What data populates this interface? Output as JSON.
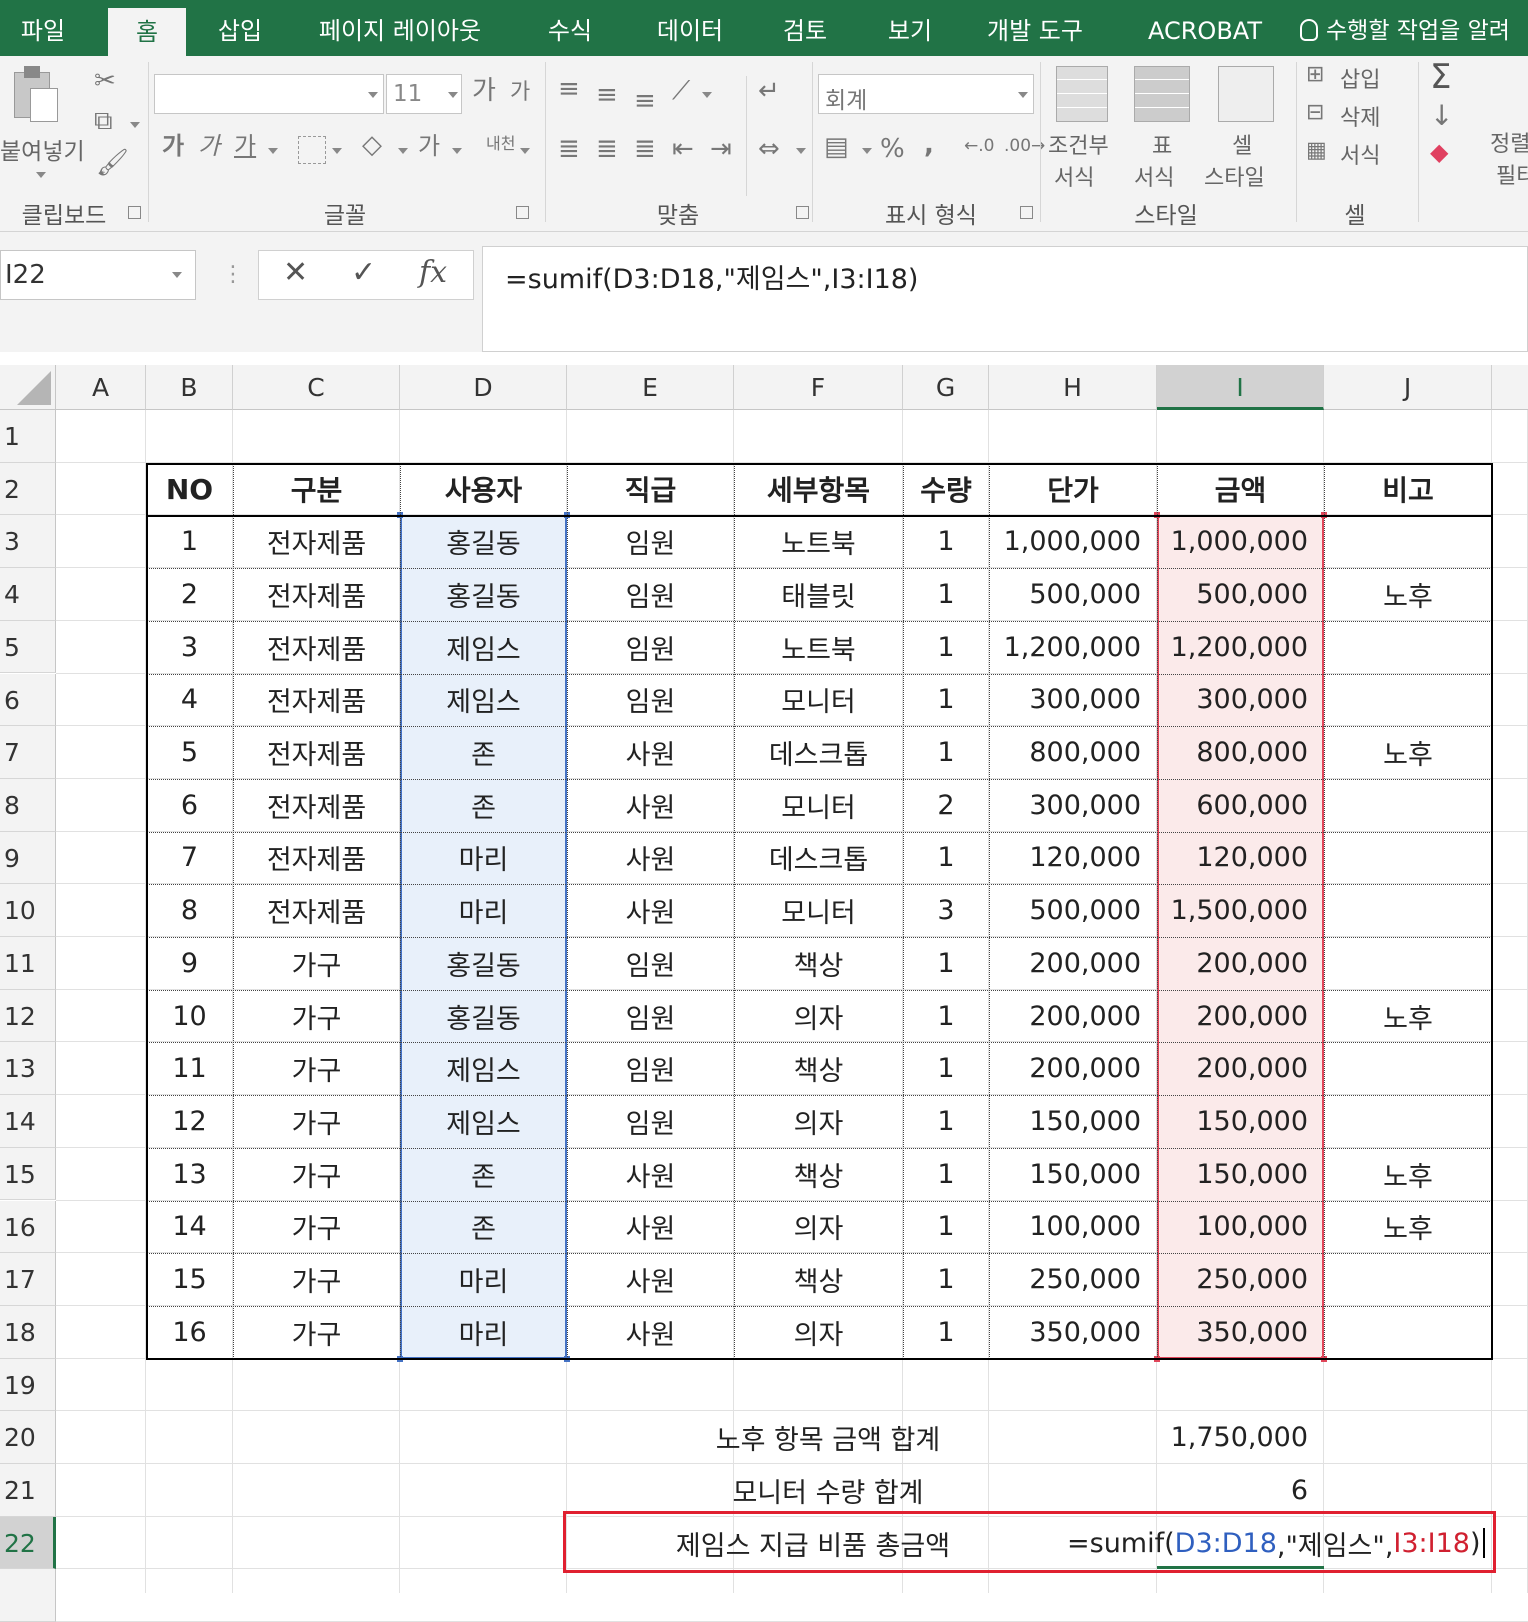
{
  "ribbon_tabs": [
    "파일",
    "홈",
    "삽입",
    "페이지 레이아웃",
    "수식",
    "데이터",
    "검토",
    "보기",
    "개발 도구",
    "ACROBAT"
  ],
  "active_tab": "홈",
  "tell_me": "수행할 작업을 알려",
  "ribbon": {
    "paste_label": "붙여넣기",
    "clipboard_group": "클립보드",
    "font_group": "글꼴",
    "font_size": "11",
    "align_group": "맞춤",
    "number_group": "표시 형식",
    "number_format": "회계",
    "styles_group": "스타일",
    "cond_format_1": "조건부",
    "cond_format_2": "서식",
    "table_format_1": "표",
    "table_format_2": "서식",
    "cell_style_1": "셀",
    "cell_style_2": "스타일",
    "cells_group": "셀",
    "insert_label": "삽입",
    "delete_label": "삭제",
    "format_label": "서식",
    "sort_label_1": "정렬",
    "sort_label_2": "필터",
    "bold": "가",
    "italic": "가",
    "underline": "가",
    "font_color": "가",
    "phonetic": "내천",
    "percent": "%",
    "comma": ","
  },
  "formula_bar": {
    "name_box": "I22",
    "cancel": "✕",
    "enter": "✓",
    "fx": "fx",
    "formula": "=sumif(D3:D18,\"제임스\",I3:I18)"
  },
  "columns": [
    "A",
    "B",
    "C",
    "D",
    "E",
    "F",
    "G",
    "H",
    "I",
    "J"
  ],
  "rows": [
    "1",
    "2",
    "3",
    "4",
    "5",
    "6",
    "7",
    "8",
    "9",
    "10",
    "11",
    "12",
    "13",
    "14",
    "15",
    "16",
    "17",
    "18",
    "19",
    "20",
    "21",
    "22"
  ],
  "table": {
    "headers": [
      "NO",
      "구분",
      "사용자",
      "직급",
      "세부항목",
      "수량",
      "단가",
      "금액",
      "비고"
    ],
    "rows": [
      [
        "1",
        "전자제품",
        "홍길동",
        "임원",
        "노트북",
        "1",
        "1,000,000",
        "1,000,000",
        ""
      ],
      [
        "2",
        "전자제품",
        "홍길동",
        "임원",
        "태블릿",
        "1",
        "500,000",
        "500,000",
        "노후"
      ],
      [
        "3",
        "전자제품",
        "제임스",
        "임원",
        "노트북",
        "1",
        "1,200,000",
        "1,200,000",
        ""
      ],
      [
        "4",
        "전자제품",
        "제임스",
        "임원",
        "모니터",
        "1",
        "300,000",
        "300,000",
        ""
      ],
      [
        "5",
        "전자제품",
        "존",
        "사원",
        "데스크톱",
        "1",
        "800,000",
        "800,000",
        "노후"
      ],
      [
        "6",
        "전자제품",
        "존",
        "사원",
        "모니터",
        "2",
        "300,000",
        "600,000",
        ""
      ],
      [
        "7",
        "전자제품",
        "마리",
        "사원",
        "데스크톱",
        "1",
        "120,000",
        "120,000",
        ""
      ],
      [
        "8",
        "전자제품",
        "마리",
        "사원",
        "모니터",
        "3",
        "500,000",
        "1,500,000",
        ""
      ],
      [
        "9",
        "가구",
        "홍길동",
        "임원",
        "책상",
        "1",
        "200,000",
        "200,000",
        ""
      ],
      [
        "10",
        "가구",
        "홍길동",
        "임원",
        "의자",
        "1",
        "200,000",
        "200,000",
        "노후"
      ],
      [
        "11",
        "가구",
        "제임스",
        "임원",
        "책상",
        "1",
        "200,000",
        "200,000",
        ""
      ],
      [
        "12",
        "가구",
        "제임스",
        "임원",
        "의자",
        "1",
        "150,000",
        "150,000",
        ""
      ],
      [
        "13",
        "가구",
        "존",
        "사원",
        "책상",
        "1",
        "150,000",
        "150,000",
        "노후"
      ],
      [
        "14",
        "가구",
        "존",
        "사원",
        "의자",
        "1",
        "100,000",
        "100,000",
        "노후"
      ],
      [
        "15",
        "가구",
        "마리",
        "사원",
        "책상",
        "1",
        "250,000",
        "250,000",
        ""
      ],
      [
        "16",
        "가구",
        "마리",
        "사원",
        "의자",
        "1",
        "350,000",
        "350,000",
        ""
      ]
    ]
  },
  "summary": {
    "old_total_label": "노후 항목 금액 합계",
    "old_total_value": "1,750,000",
    "monitor_qty_label": "모니터 수량 합계",
    "monitor_qty_value": "6",
    "james_total_label": "제임스 지급 비품 총금액",
    "james_formula_prefix": "=sumif(",
    "james_formula_range1": "D3:D18",
    "james_formula_criteria": ",\"제임스\",",
    "james_formula_range2": "I3:I18",
    "james_formula_suffix": ")"
  },
  "colors": {
    "excel_green": "#217346",
    "criteria_range": "#4472c4",
    "sum_range": "#e0465a",
    "callout_box": "#e02030"
  }
}
